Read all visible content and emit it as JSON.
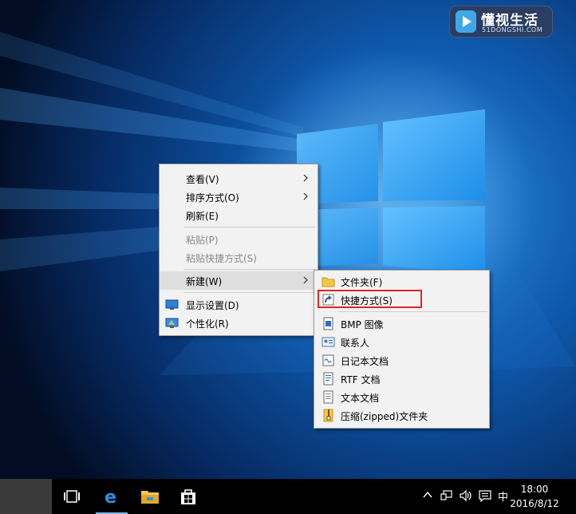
{
  "watermark": {
    "title": "懂视生活",
    "subtitle": "51DONGSHI.COM"
  },
  "context_menu": {
    "items": [
      {
        "label": "查看(V)",
        "submenu": true
      },
      {
        "label": "排序方式(O)",
        "submenu": true
      },
      {
        "label": "刷新(E)"
      },
      {
        "label": "粘贴(P)",
        "disabled": true
      },
      {
        "label": "粘贴快捷方式(S)",
        "disabled": true
      },
      {
        "label": "新建(W)",
        "submenu": true,
        "highlighted": true
      },
      {
        "label": "显示设置(D)",
        "icon": "display-settings-icon"
      },
      {
        "label": "个性化(R)",
        "icon": "personalize-icon"
      }
    ]
  },
  "new_submenu": {
    "items": [
      {
        "label": "文件夹(F)",
        "icon": "folder-icon"
      },
      {
        "label": "快捷方式(S)",
        "icon": "shortcut-icon",
        "annotated": true
      },
      {
        "label": "BMP 图像",
        "icon": "bmp-image-icon"
      },
      {
        "label": "联系人",
        "icon": "contact-icon"
      },
      {
        "label": "日记本文档",
        "icon": "journal-icon"
      },
      {
        "label": "RTF 文档",
        "icon": "rtf-document-icon"
      },
      {
        "label": "文本文档",
        "icon": "text-document-icon"
      },
      {
        "label": "压缩(zipped)文件夹",
        "icon": "zip-folder-icon"
      }
    ]
  },
  "taskbar": {
    "apps": [
      "task-view-icon",
      "edge-icon",
      "file-explorer-icon",
      "store-icon"
    ],
    "tray": {
      "input_language": "中",
      "time": "18:00",
      "date": "2016/8/12"
    }
  },
  "colors": {
    "annotation": "#e12424",
    "taskbar": "#000000",
    "menu_bg": "#f2f2f2"
  }
}
